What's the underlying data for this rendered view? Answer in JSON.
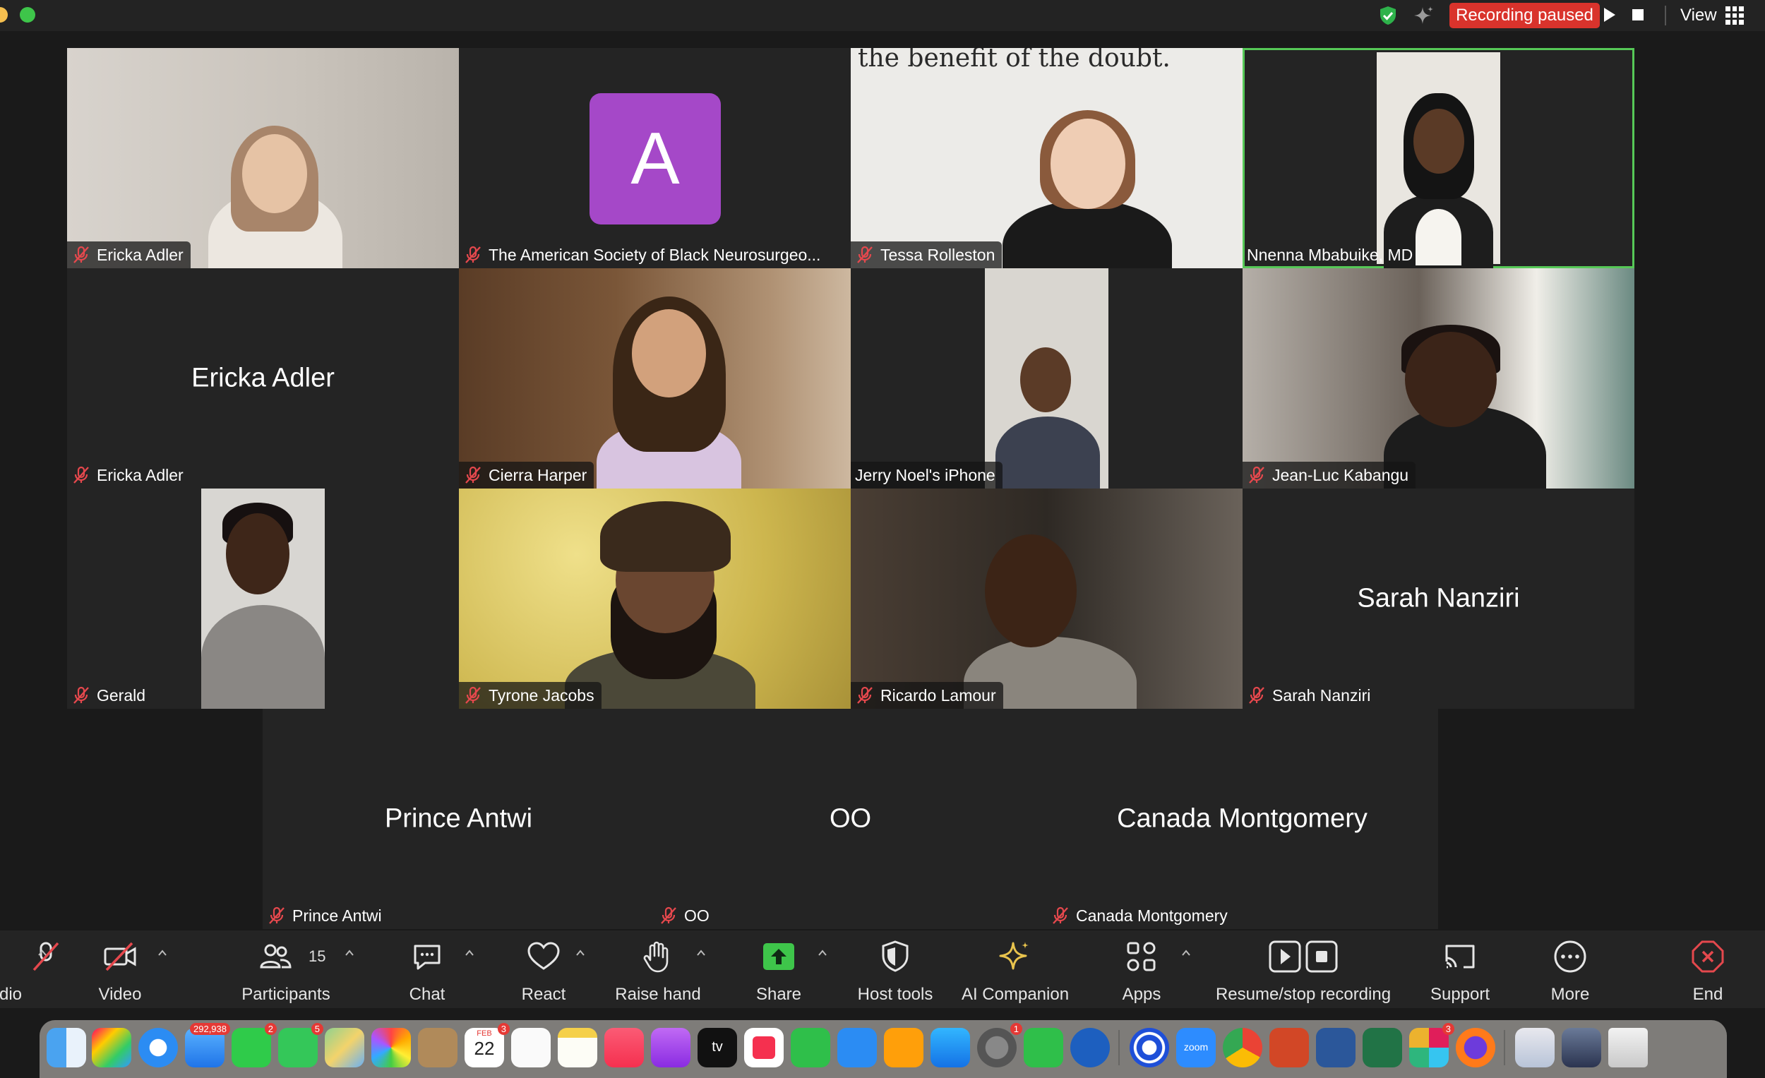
{
  "header": {
    "recording_status": "Recording paused",
    "view_label": "View"
  },
  "participants_grid": [
    {
      "name": "Ericka Adler",
      "label": "Ericka Adler"
    },
    {
      "name": "The American Society of Black Neurosurgeons",
      "label": "The American Society of Black Neurosurgeo...",
      "avatar_letter": "A"
    },
    {
      "name": "Tessa Rolleston",
      "label": "Tessa Rolleston",
      "background_text": "the benefit of the doubt."
    },
    {
      "name": "Nnenna Mbabuike, MD",
      "label": "Nnenna Mbabuike, MD"
    },
    {
      "name": "Ericka Adler",
      "label": "Ericka Adler",
      "display_name": "Ericka Adler"
    },
    {
      "name": "Cierra Harper",
      "label": "Cierra Harper"
    },
    {
      "name": "Jerry Noel's iPhone",
      "label": "Jerry Noel's iPhone"
    },
    {
      "name": "Jean-Luc Kabangu",
      "label": "Jean-Luc Kabangu"
    },
    {
      "name": "Gerald",
      "label": "Gerald"
    },
    {
      "name": "Tyrone Jacobs",
      "label": "Tyrone Jacobs"
    },
    {
      "name": "Ricardo Lamour",
      "label": "Ricardo Lamour"
    },
    {
      "name": "Sarah Nanziri",
      "label": "Sarah Nanziri",
      "display_name": "Sarah Nanziri"
    },
    {
      "name": "Prince Antwi",
      "label": "Prince Antwi",
      "display_name": "Prince Antwi"
    },
    {
      "name": "OO",
      "label": "OO",
      "display_name": "OO"
    },
    {
      "name": "Canada Montgomery",
      "label": "Canada Montgomery",
      "display_name": "Canada Montgomery"
    }
  ],
  "toolbar": {
    "audio_label": "dio",
    "video_label": "Video",
    "participants_label": "Participants",
    "participants_count": "15",
    "chat_label": "Chat",
    "react_label": "React",
    "raise_hand_label": "Raise hand",
    "share_label": "Share",
    "host_tools_label": "Host tools",
    "ai_companion_label": "AI Companion",
    "apps_label": "Apps",
    "recording_label": "Resume/stop recording",
    "support_label": "Support",
    "more_label": "More",
    "end_label": "End"
  },
  "dock": {
    "mail_badge": "292,938",
    "facetime_badge": "2",
    "messages_badge": "5",
    "calendar_month": "FEB",
    "calendar_day": "22",
    "calendar_badge": "3",
    "settings_badge": "1",
    "slack_badge": "3",
    "zoom_label": "zoom",
    "tv_label": "tv"
  },
  "colors": {
    "accent_green": "#56c857",
    "recording_red": "#d9332c",
    "end_red": "#e5484d",
    "share_green": "#3ec54a",
    "avatar_purple": "#a548c8"
  }
}
